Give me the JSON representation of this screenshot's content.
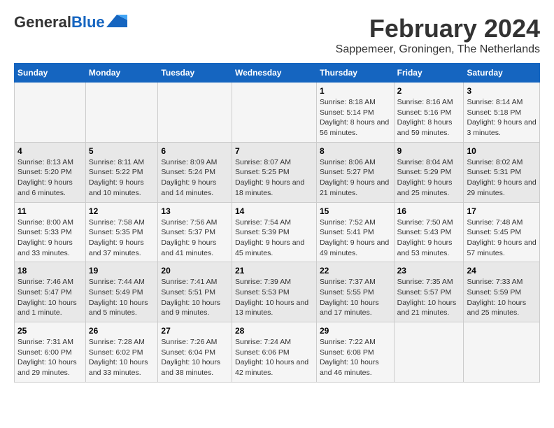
{
  "header": {
    "logo_line1": "General",
    "logo_line2": "Blue",
    "main_title": "February 2024",
    "subtitle": "Sappemeer, Groningen, The Netherlands"
  },
  "days_of_week": [
    "Sunday",
    "Monday",
    "Tuesday",
    "Wednesday",
    "Thursday",
    "Friday",
    "Saturday"
  ],
  "weeks": [
    [
      {
        "num": "",
        "info": ""
      },
      {
        "num": "",
        "info": ""
      },
      {
        "num": "",
        "info": ""
      },
      {
        "num": "",
        "info": ""
      },
      {
        "num": "1",
        "info": "Sunrise: 8:18 AM\nSunset: 5:14 PM\nDaylight: 8 hours\nand 56 minutes."
      },
      {
        "num": "2",
        "info": "Sunrise: 8:16 AM\nSunset: 5:16 PM\nDaylight: 8 hours\nand 59 minutes."
      },
      {
        "num": "3",
        "info": "Sunrise: 8:14 AM\nSunset: 5:18 PM\nDaylight: 9 hours\nand 3 minutes."
      }
    ],
    [
      {
        "num": "4",
        "info": "Sunrise: 8:13 AM\nSunset: 5:20 PM\nDaylight: 9 hours\nand 6 minutes."
      },
      {
        "num": "5",
        "info": "Sunrise: 8:11 AM\nSunset: 5:22 PM\nDaylight: 9 hours\nand 10 minutes."
      },
      {
        "num": "6",
        "info": "Sunrise: 8:09 AM\nSunset: 5:24 PM\nDaylight: 9 hours\nand 14 minutes."
      },
      {
        "num": "7",
        "info": "Sunrise: 8:07 AM\nSunset: 5:25 PM\nDaylight: 9 hours\nand 18 minutes."
      },
      {
        "num": "8",
        "info": "Sunrise: 8:06 AM\nSunset: 5:27 PM\nDaylight: 9 hours\nand 21 minutes."
      },
      {
        "num": "9",
        "info": "Sunrise: 8:04 AM\nSunset: 5:29 PM\nDaylight: 9 hours\nand 25 minutes."
      },
      {
        "num": "10",
        "info": "Sunrise: 8:02 AM\nSunset: 5:31 PM\nDaylight: 9 hours\nand 29 minutes."
      }
    ],
    [
      {
        "num": "11",
        "info": "Sunrise: 8:00 AM\nSunset: 5:33 PM\nDaylight: 9 hours\nand 33 minutes."
      },
      {
        "num": "12",
        "info": "Sunrise: 7:58 AM\nSunset: 5:35 PM\nDaylight: 9 hours\nand 37 minutes."
      },
      {
        "num": "13",
        "info": "Sunrise: 7:56 AM\nSunset: 5:37 PM\nDaylight: 9 hours\nand 41 minutes."
      },
      {
        "num": "14",
        "info": "Sunrise: 7:54 AM\nSunset: 5:39 PM\nDaylight: 9 hours\nand 45 minutes."
      },
      {
        "num": "15",
        "info": "Sunrise: 7:52 AM\nSunset: 5:41 PM\nDaylight: 9 hours\nand 49 minutes."
      },
      {
        "num": "16",
        "info": "Sunrise: 7:50 AM\nSunset: 5:43 PM\nDaylight: 9 hours\nand 53 minutes."
      },
      {
        "num": "17",
        "info": "Sunrise: 7:48 AM\nSunset: 5:45 PM\nDaylight: 9 hours\nand 57 minutes."
      }
    ],
    [
      {
        "num": "18",
        "info": "Sunrise: 7:46 AM\nSunset: 5:47 PM\nDaylight: 10 hours\nand 1 minute."
      },
      {
        "num": "19",
        "info": "Sunrise: 7:44 AM\nSunset: 5:49 PM\nDaylight: 10 hours\nand 5 minutes."
      },
      {
        "num": "20",
        "info": "Sunrise: 7:41 AM\nSunset: 5:51 PM\nDaylight: 10 hours\nand 9 minutes."
      },
      {
        "num": "21",
        "info": "Sunrise: 7:39 AM\nSunset: 5:53 PM\nDaylight: 10 hours\nand 13 minutes."
      },
      {
        "num": "22",
        "info": "Sunrise: 7:37 AM\nSunset: 5:55 PM\nDaylight: 10 hours\nand 17 minutes."
      },
      {
        "num": "23",
        "info": "Sunrise: 7:35 AM\nSunset: 5:57 PM\nDaylight: 10 hours\nand 21 minutes."
      },
      {
        "num": "24",
        "info": "Sunrise: 7:33 AM\nSunset: 5:59 PM\nDaylight: 10 hours\nand 25 minutes."
      }
    ],
    [
      {
        "num": "25",
        "info": "Sunrise: 7:31 AM\nSunset: 6:00 PM\nDaylight: 10 hours\nand 29 minutes."
      },
      {
        "num": "26",
        "info": "Sunrise: 7:28 AM\nSunset: 6:02 PM\nDaylight: 10 hours\nand 33 minutes."
      },
      {
        "num": "27",
        "info": "Sunrise: 7:26 AM\nSunset: 6:04 PM\nDaylight: 10 hours\nand 38 minutes."
      },
      {
        "num": "28",
        "info": "Sunrise: 7:24 AM\nSunset: 6:06 PM\nDaylight: 10 hours\nand 42 minutes."
      },
      {
        "num": "29",
        "info": "Sunrise: 7:22 AM\nSunset: 6:08 PM\nDaylight: 10 hours\nand 46 minutes."
      },
      {
        "num": "",
        "info": ""
      },
      {
        "num": "",
        "info": ""
      }
    ]
  ]
}
